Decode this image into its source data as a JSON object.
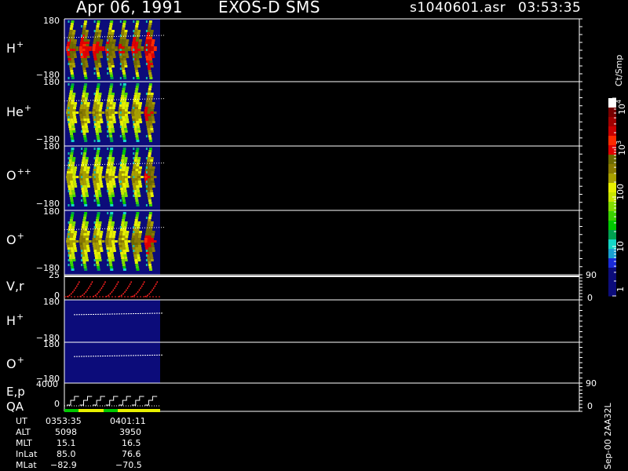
{
  "header": {
    "date": "Apr 06, 1991",
    "mission": "EXOS-D SMS",
    "file": "s1040601.asr",
    "time": "03:53:35"
  },
  "panels": [
    {
      "name": "H",
      "sup": "+",
      "top": "180",
      "bottom": "−180"
    },
    {
      "name": "He",
      "sup": "+",
      "top": "180",
      "bottom": "−180"
    },
    {
      "name": "O",
      "sup": "++",
      "top": "180",
      "bottom": "−180"
    },
    {
      "name": "O",
      "sup": "+",
      "top": "180",
      "bottom": "−180"
    }
  ],
  "vr_panel": {
    "label": "V,r",
    "left_top": "25",
    "left_bottom": "0",
    "right_top": "90",
    "right_bottom": "0"
  },
  "angle_panels": [
    {
      "name": "H",
      "sup": "+",
      "top": "180",
      "bottom": "−180"
    },
    {
      "name": "O",
      "sup": "+",
      "top": "180",
      "bottom": "−180"
    }
  ],
  "ep_panel": {
    "label": "E,p",
    "label2": "QA",
    "left_top": "4000",
    "left_bottom": "0",
    "right_top": "90",
    "right_bottom": "0"
  },
  "colorbar": {
    "unit": "Ct/Smp",
    "ticks": [
      {
        "base": "1",
        "exp": ""
      },
      {
        "base": "10",
        "exp": ""
      },
      {
        "base": "100",
        "exp": ""
      },
      {
        "base": "10",
        "exp": "3"
      },
      {
        "base": "10",
        "exp": "4"
      }
    ],
    "colors": [
      "#0c0c7a",
      "#0c0c7a",
      "#0c0c7a",
      "#1a2bd8",
      "#19a0d0",
      "#14d6c6",
      "#00a050",
      "#00c800",
      "#3ad200",
      "#80dc00",
      "#c8e600",
      "#e8f000",
      "#a8a000",
      "#8a7a00",
      "#6e6a00",
      "#e00000",
      "#ff2a00",
      "#c80000",
      "#a00000",
      "#780000",
      "#ffffff"
    ]
  },
  "ephemeris": {
    "rows": [
      {
        "label": "UT",
        "v1": "0353:35",
        "v2": "0401:11"
      },
      {
        "label": "ALT",
        "v1": "5098",
        "v2": "3950"
      },
      {
        "label": "MLT",
        "v1": "15.1",
        "v2": "16.5"
      },
      {
        "label": "InLat",
        "v1": "85.0",
        "v2": "76.6"
      },
      {
        "label": "MLat",
        "v1": "−82.9",
        "v2": "−70.5"
      }
    ]
  },
  "stamp": "Sep-00  2AA32L",
  "chart_data": {
    "type": "heatmap",
    "title": "Apr 06, 1991   EXOS-D SMS",
    "x_time_range": [
      "0353:35",
      "0401:11"
    ],
    "y_range_pitch": [
      -180,
      180
    ],
    "colorbar_range": [
      1,
      10000
    ],
    "colorbar_scale": "log",
    "species": [
      "H+",
      "He+",
      "O++",
      "O+"
    ],
    "spin_sweeps": 7,
    "sweep_peak_levels": {
      "H+": [
        1000,
        1500,
        1200,
        900,
        800,
        1200,
        3000
      ],
      "He+": [
        300,
        400,
        350,
        300,
        250,
        400,
        900
      ],
      "O++": [
        250,
        300,
        300,
        250,
        250,
        350,
        900
      ],
      "O+": [
        300,
        400,
        350,
        300,
        300,
        500,
        1200
      ]
    },
    "vr_right_range": [
      0,
      90
    ],
    "vr_left_range": [
      0,
      25
    ],
    "ep_left_range": [
      0,
      4000
    ],
    "ep_right_range": [
      0,
      90
    ]
  }
}
